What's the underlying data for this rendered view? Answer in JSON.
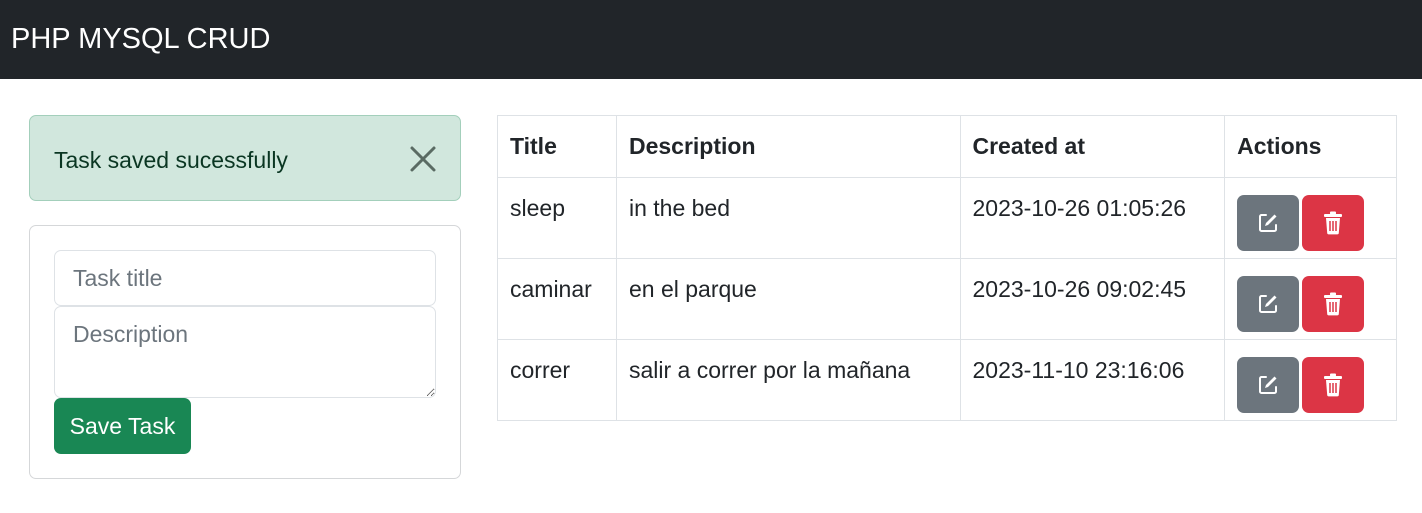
{
  "navbar": {
    "brand": "PHP MYSQL CRUD"
  },
  "alert": {
    "message": "Task saved sucessfully",
    "close_icon": "close-icon"
  },
  "form": {
    "title_placeholder": "Task title",
    "title_value": "",
    "description_placeholder": "Description",
    "description_value": "",
    "save_label": "Save Task"
  },
  "table": {
    "headers": {
      "title": "Title",
      "description": "Description",
      "created_at": "Created at",
      "actions": "Actions"
    },
    "rows": [
      {
        "title": "sleep",
        "description": "in the bed",
        "created_at": "2023-10-26 01:05:26"
      },
      {
        "title": "caminar",
        "description": "en el parque",
        "created_at": "2023-10-26 09:02:45"
      },
      {
        "title": "correr",
        "description": "salir a correr por la mañana",
        "created_at": "2023-11-10 23:16:06"
      }
    ],
    "action_icons": {
      "edit": "edit-icon",
      "delete": "trash-icon"
    }
  },
  "colors": {
    "navbar_bg": "#212529",
    "alert_bg": "#d1e7dd",
    "save_button": "#198754",
    "edit_button": "#6c757d",
    "delete_button": "#dc3545"
  }
}
